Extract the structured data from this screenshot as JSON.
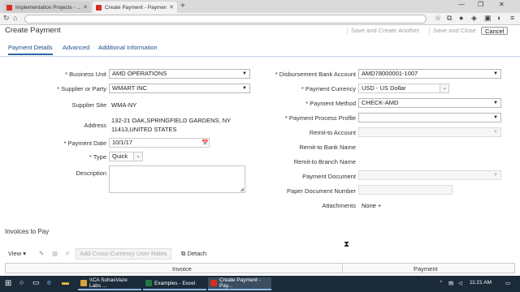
{
  "browser": {
    "tabs": [
      {
        "label": "Implementation Projects - ..."
      },
      {
        "label": "Create Payment - Paymen..."
      }
    ],
    "new_tab": "+",
    "window_controls": {
      "minimize": "—",
      "restore": "❐",
      "close": "✕"
    }
  },
  "header": {
    "title": "Create Payment",
    "save_create_another": "Save and Create Another",
    "save_close": "Save and Close",
    "cancel": "Cancel"
  },
  "tabs": [
    "Payment Details",
    "Advanced",
    "Additional Information"
  ],
  "form_left": {
    "business_unit": {
      "label": "Business Unit",
      "value": "AMD OPERATIONS"
    },
    "supplier": {
      "label": "Supplier or Party",
      "value": "WMART INC"
    },
    "supplier_site": {
      "label": "Supplier Site",
      "value": "WMA-NY"
    },
    "address": {
      "label": "Address",
      "line1": "132-21 OAK,SPRINGFIELD GARDENS, NY",
      "line2": "11413,UNITED STATES"
    },
    "payment_date": {
      "label": "Payment Date",
      "value": "10/1/17"
    },
    "type": {
      "label": "Type",
      "value": "Quick"
    },
    "description": {
      "label": "Description",
      "value": ""
    }
  },
  "form_right": {
    "disbursement_bank": {
      "label": "Disbursement Bank Account",
      "value": "AMD78000001-1007"
    },
    "payment_currency": {
      "label": "Payment Currency",
      "value": "USD - US Dollar"
    },
    "payment_method": {
      "label": "Payment Method",
      "value": "CHECK-AMD"
    },
    "payment_process_profile": {
      "label": "Payment Process Profile",
      "value": ""
    },
    "remit_to_account": {
      "label": "Remit-to Account",
      "value": ""
    },
    "remit_to_bank_name": {
      "label": "Remit-to Bank Name"
    },
    "remit_to_branch_name": {
      "label": "Remit-to Branch Name"
    },
    "payment_document": {
      "label": "Payment Document",
      "value": ""
    },
    "paper_document_number": {
      "label": "Paper Document Number",
      "value": ""
    },
    "attachments": {
      "label": "Attachments",
      "value": "None"
    }
  },
  "invoices": {
    "title": "Invoices to Pay",
    "view_label": "View",
    "add_rates": "Add Cross-Currency User Rates",
    "detach": "Detach",
    "columns": [
      "Invoice",
      "Payment"
    ]
  },
  "taskbar": {
    "apps": [
      {
        "label": "\\\\CA SuhasVaze Labs ...",
        "color": "#d8a23a"
      },
      {
        "label": "Examples - Excel",
        "color": "#1e7a44"
      },
      {
        "label": "Create Payment - Pay...",
        "color": "#d62d20"
      }
    ],
    "time": "11:21 AM"
  }
}
